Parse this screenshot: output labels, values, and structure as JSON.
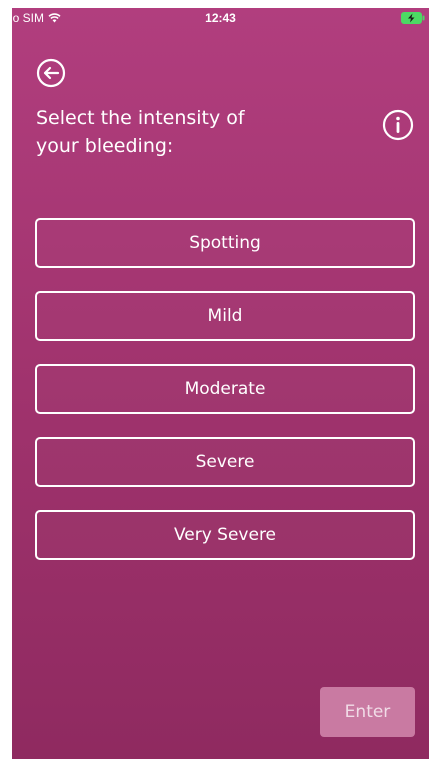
{
  "status_bar": {
    "carrier": "No SIM",
    "time": "12:43",
    "wifi_icon": "wifi-icon",
    "battery_icon": "battery-charging-icon"
  },
  "header": {
    "back_icon": "arrow-left-circle-icon",
    "title": "Select the intensity of\nyour bleeding:",
    "info_icon": "info-circle-icon"
  },
  "options": [
    {
      "label": "Spotting"
    },
    {
      "label": "Mild"
    },
    {
      "label": "Moderate"
    },
    {
      "label": "Severe"
    },
    {
      "label": "Very Severe"
    }
  ],
  "footer": {
    "enter_label": "Enter"
  },
  "colors": {
    "background_top": "#b13e7e",
    "background_bottom": "#8f2a60",
    "enter_button_disabled": "#c97aa2",
    "text": "#ffffff",
    "battery_green": "#4cd964"
  }
}
